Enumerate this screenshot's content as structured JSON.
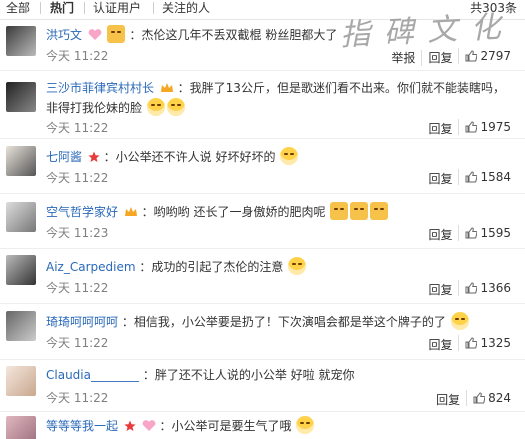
{
  "tabs": [
    {
      "label": "全部"
    },
    {
      "label": "热门"
    },
    {
      "label": "认证用户"
    },
    {
      "label": "关注的人"
    }
  ],
  "total_count": "共303条",
  "watermark": "指 碑 文 化",
  "comments": [
    {
      "username": "洪巧文",
      "text": "：杰伦这几年不丢双截棍 粉丝胆都大了",
      "time": "今天 11:22",
      "likes": "2797",
      "report": "举报",
      "reply": "回复"
    },
    {
      "username": "三沙市菲律宾村村长",
      "text": "：我胖了13公斤，但是歌迷们看不出来。你们就不能装瞎吗，",
      "text2": "非得打我伦妹的脸",
      "time": "今天 11:22",
      "likes": "1975",
      "reply": "回复"
    },
    {
      "username": "七阿酱",
      "text": "：小公举还不许人说 好坏好坏的",
      "time": "今天 11:22",
      "likes": "1584",
      "reply": "回复"
    },
    {
      "username": "空气哲学家好",
      "text": "：哟哟哟  还长了一身傲娇的肥肉呢",
      "time": "今天 11:23",
      "likes": "1595",
      "reply": "回复"
    },
    {
      "username": "Aiz_Carpediem",
      "text": "：成功的引起了杰伦的注意",
      "time": "今天 11:22",
      "likes": "1366",
      "reply": "回复"
    },
    {
      "username": "琦琦呵呵呵呵",
      "text": "：相信我，小公举要是扔了！下次演唱会都是举这个牌子的了",
      "time": "今天 11:22",
      "likes": "1325",
      "reply": "回复"
    },
    {
      "username": "Claudia________",
      "text": "：胖了还不让人说的小公举 好啦 就宠你",
      "time": "今天 11:22",
      "likes": "824",
      "reply": "回复"
    },
    {
      "username": "等等等我一起",
      "text": "：小公举可是要生气了哦",
      "time": "",
      "likes": "",
      "reply": ""
    }
  ]
}
